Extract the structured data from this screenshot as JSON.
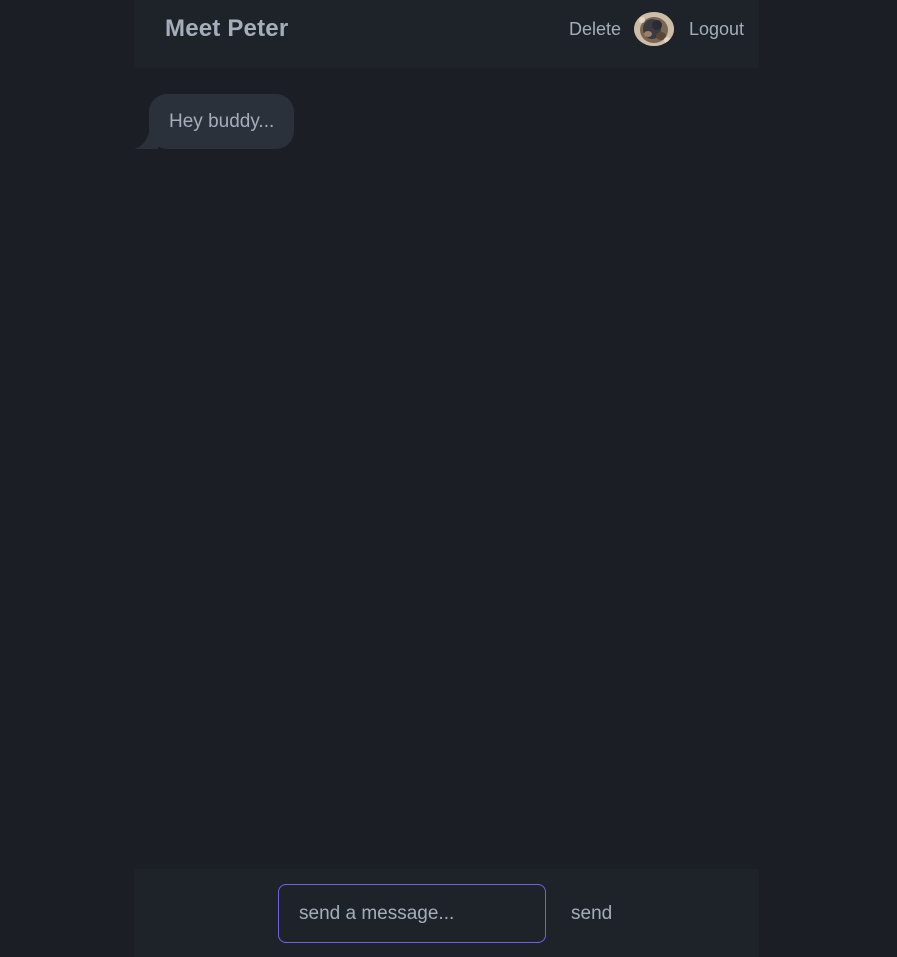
{
  "header": {
    "title": "Meet Peter",
    "delete_label": "Delete",
    "logout_label": "Logout",
    "avatar_icon": "user-avatar-photo"
  },
  "messages": [
    {
      "sender": "bot",
      "text": "Hey buddy..."
    }
  ],
  "composer": {
    "placeholder": "send a message...",
    "value": "",
    "send_label": "send"
  },
  "colors": {
    "background": "#1b1e25",
    "panel": "#1e232a",
    "bubble": "#2a313b",
    "text": "#a5adba",
    "accent": "#6e63e6"
  }
}
